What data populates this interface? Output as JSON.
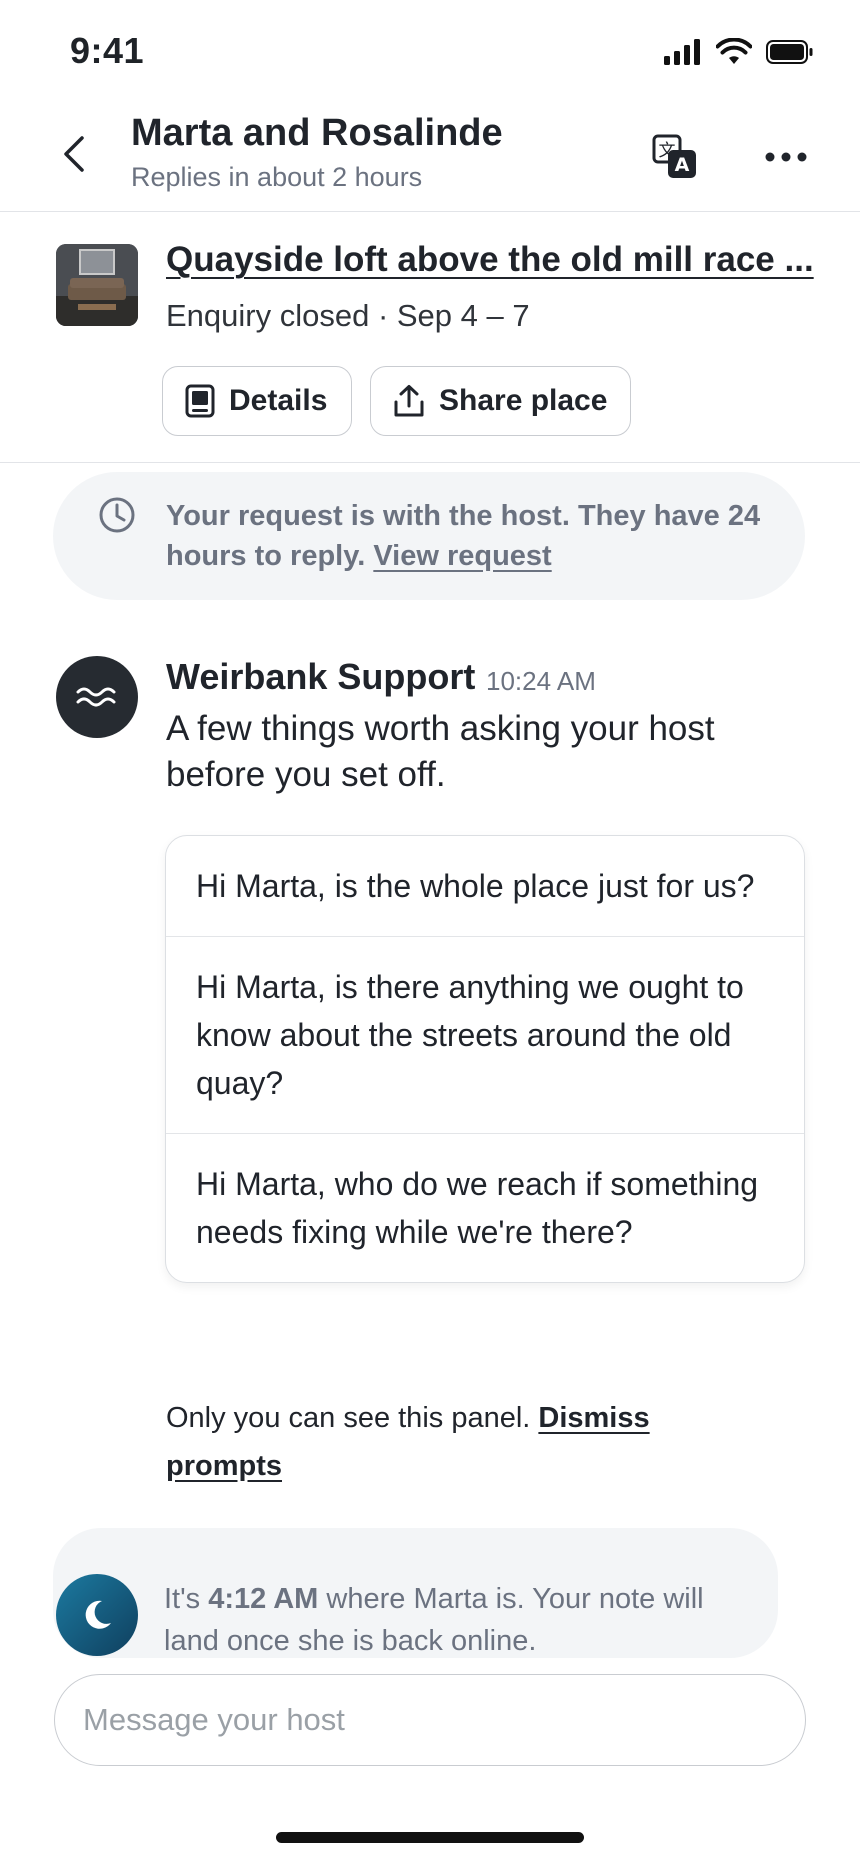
{
  "status_bar": {
    "time": "9:41"
  },
  "header": {
    "title": "Marta and Rosalinde",
    "subtitle": "Replies in about 2 hours"
  },
  "listing": {
    "title": "Quayside loft above the old mill race ...",
    "status": "Enquiry closed · Sep 4 – 7",
    "details_label": "Details",
    "share_label": "Share place"
  },
  "notice": {
    "text": "Your request is with the host. They have 24 hours to reply.",
    "link": "View request"
  },
  "message": {
    "sender": "Weirbank Support",
    "time": "10:24 AM",
    "body": "A few things worth asking your host before you set off.",
    "prompts": [
      "Hi Marta, is the whole place just for us?",
      "Hi Marta, is there anything we ought to know about the streets around the old quay?",
      "Hi Marta, who do we reach if something needs fixing while we're there?"
    ],
    "panel_note": "Only you can see this panel.",
    "dismiss_label": "Dismiss prompts"
  },
  "timezone": {
    "prefix": "It's",
    "local_time": "4:12 AM",
    "suffix": "where Marta is. Your note will land once she is back online."
  },
  "composer": {
    "placeholder": "Message your host"
  },
  "colors": {
    "accent_dark": "#262b31",
    "muted": "#6b7280",
    "moon_avatar": "#1c7aa0"
  }
}
